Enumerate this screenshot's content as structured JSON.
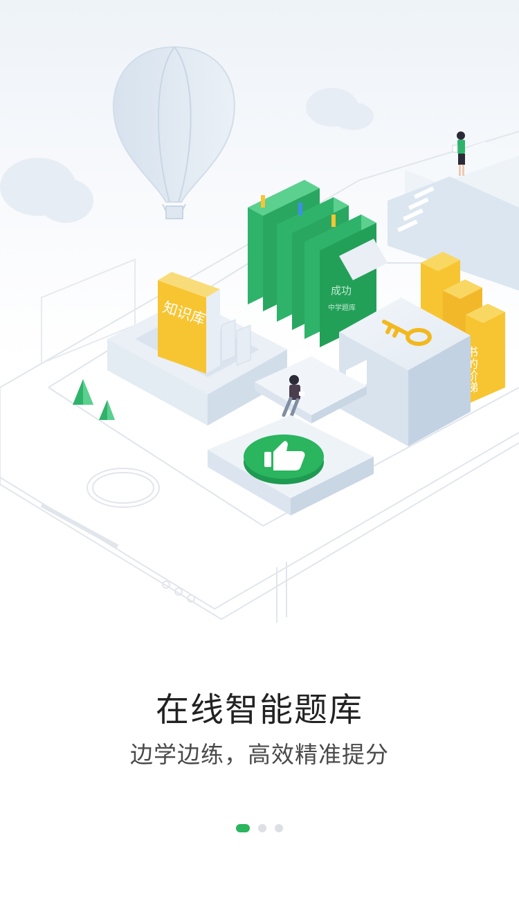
{
  "onboarding": {
    "title": "在线智能题库",
    "subtitle": "边学边练，高效精准提分",
    "current_page": 1,
    "total_pages": 3
  },
  "illustration": {
    "book_label": "知识库",
    "green_book_label": "成功",
    "green_book_sublabel": "中学题库",
    "yellow_book_label": "书的阶梯"
  },
  "colors": {
    "accent": "#2ab55e",
    "book_yellow": "#f7c531",
    "book_green": "#2fb36b",
    "dot_inactive": "#dcdfe4",
    "title_text": "#222222"
  }
}
